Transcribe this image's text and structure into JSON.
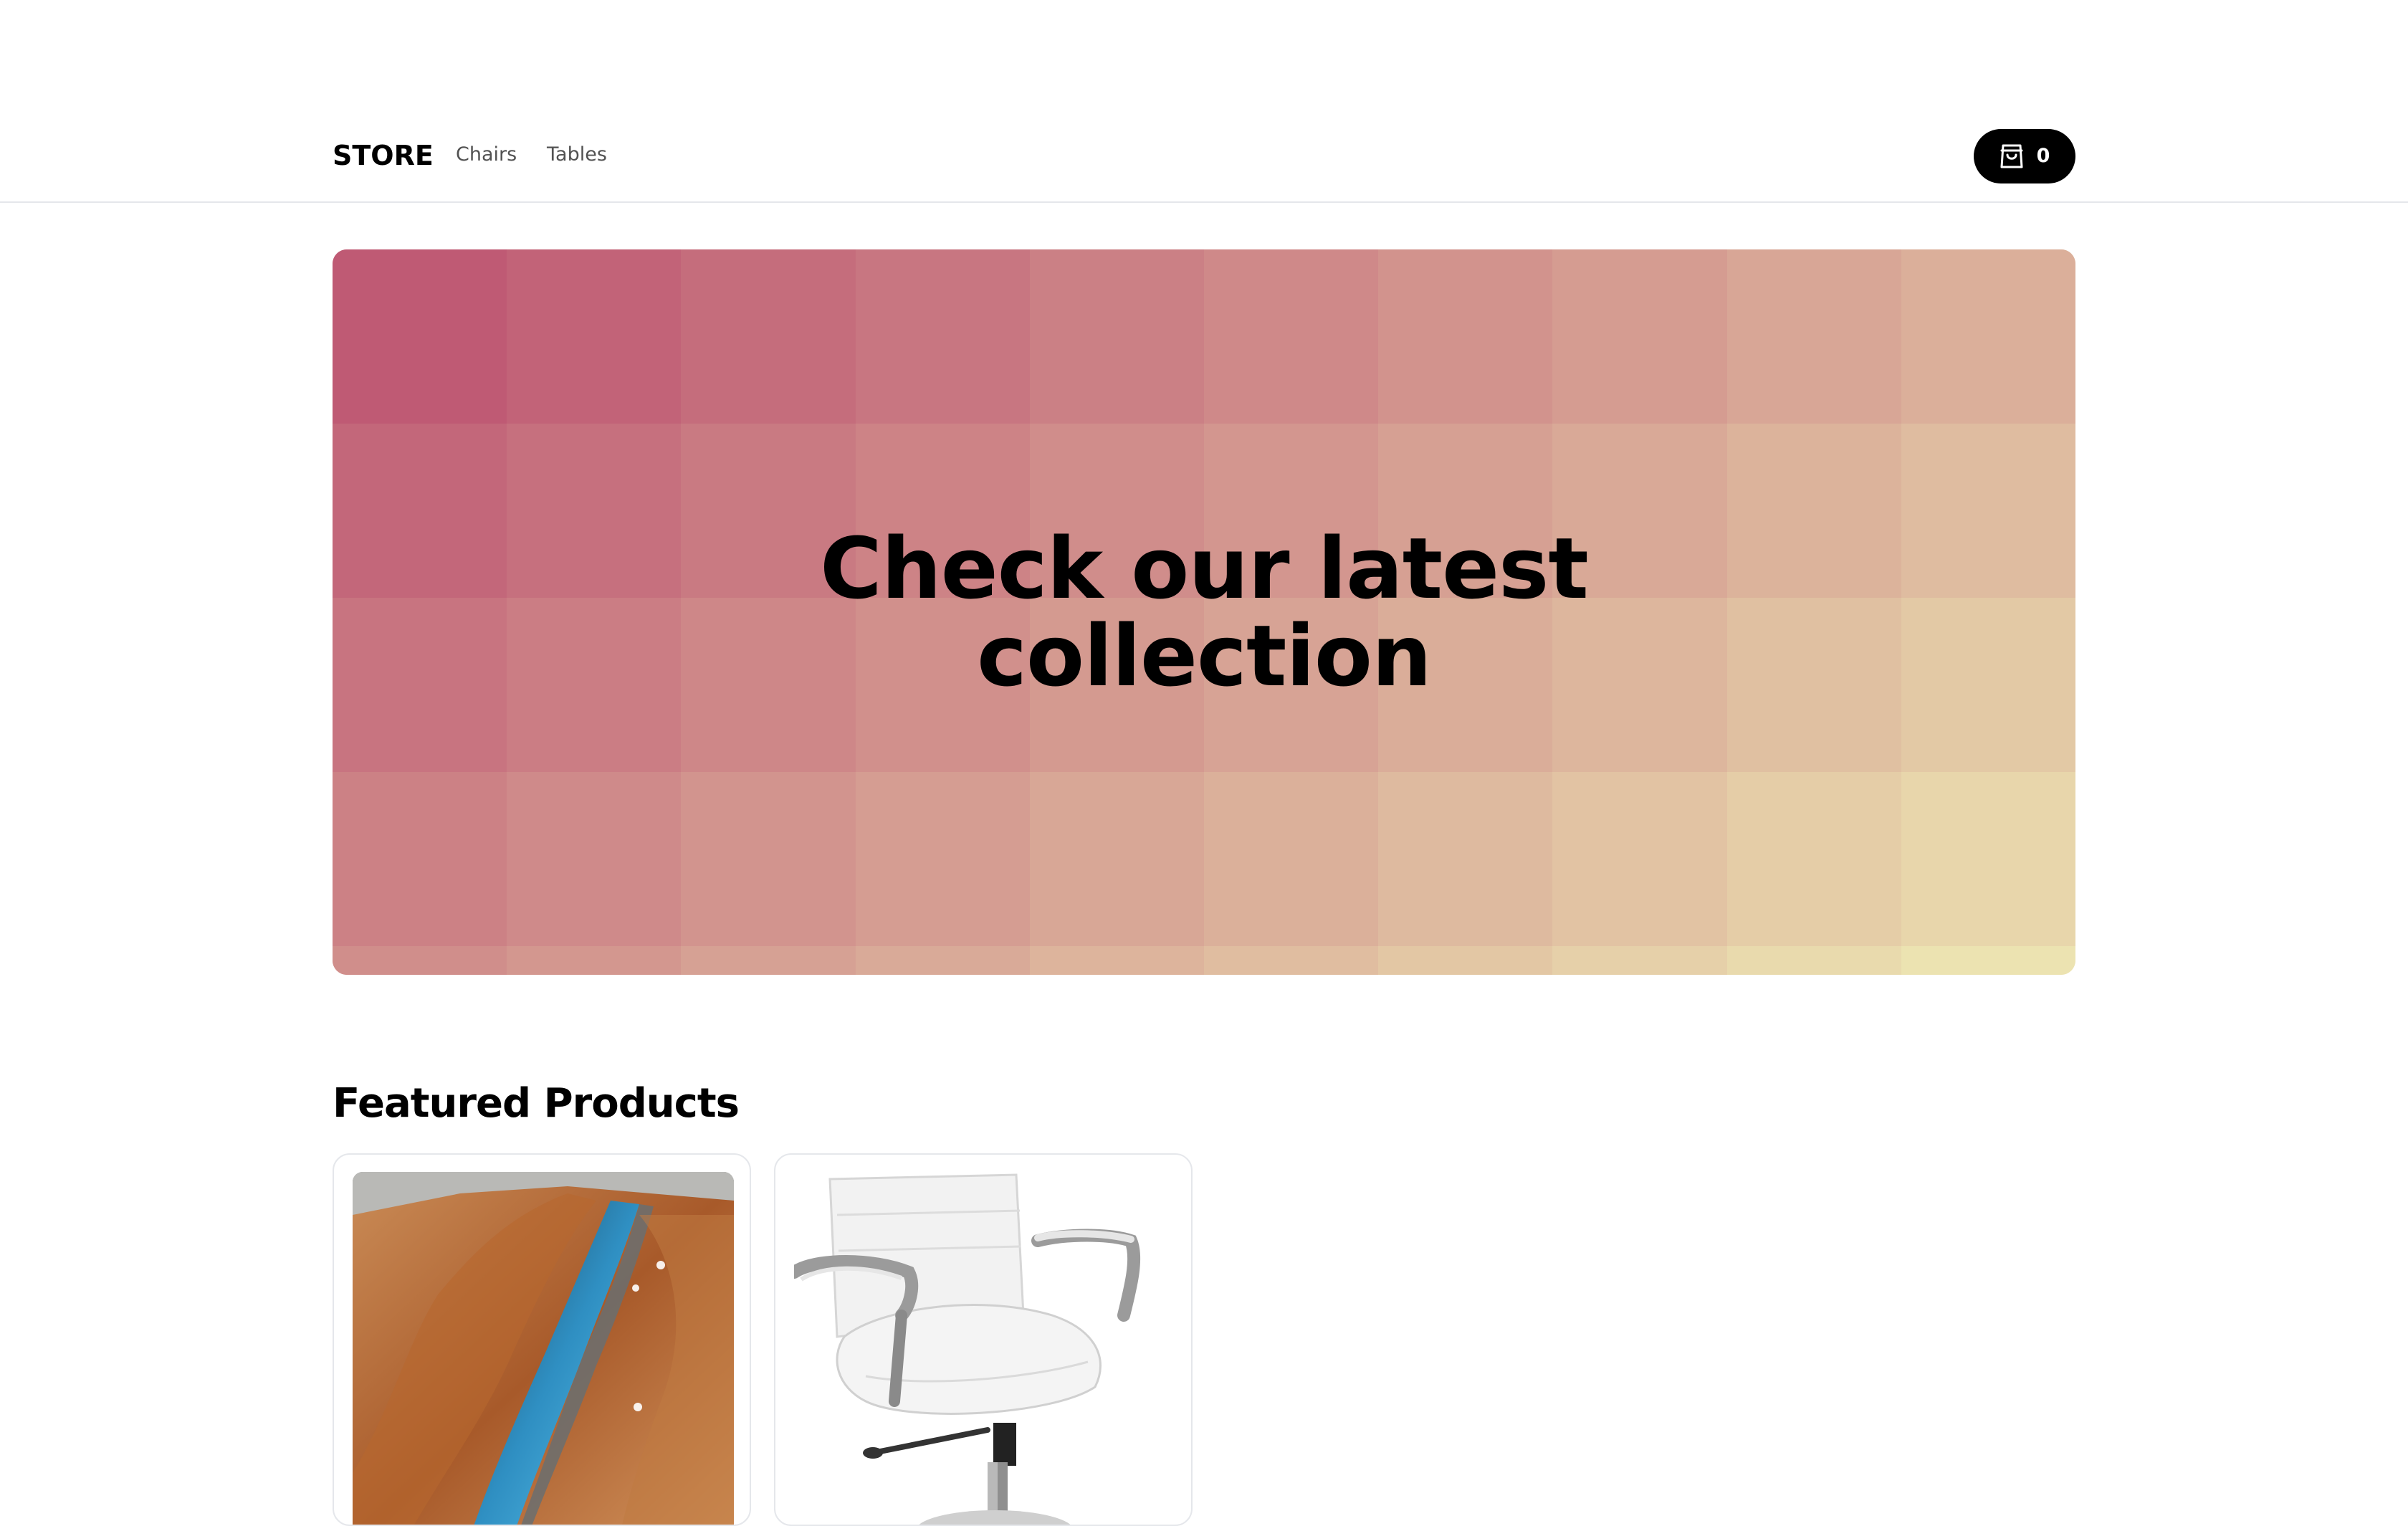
{
  "navbar": {
    "brand": "STORE",
    "links": [
      {
        "label": "Chairs"
      },
      {
        "label": "Tables"
      }
    ],
    "cart": {
      "icon": "shopping-bag-icon",
      "count": "0"
    }
  },
  "hero": {
    "title": "Check our latest collection",
    "colors": {
      "top_left": "#bf5a74",
      "bottom_right": "#ece3b1"
    }
  },
  "featured": {
    "title": "Featured Products",
    "products": [
      {
        "image": "resin-river-table-image"
      },
      {
        "image": "white-office-chair-image"
      }
    ]
  },
  "colors": {
    "accent": "#000000",
    "nav_text": "#525252",
    "border": "#e5e7eb"
  }
}
